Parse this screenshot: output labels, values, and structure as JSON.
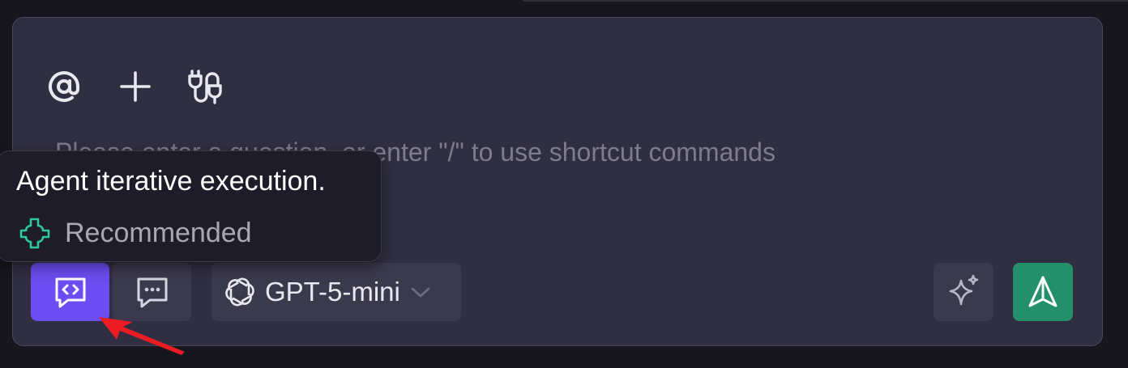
{
  "composer": {
    "toolbar_icons": [
      "at-sign-icon",
      "plus-icon",
      "plug-icon"
    ],
    "input_placeholder": "Please enter a question, or enter \"/\" to use shortcut commands",
    "input_value": ""
  },
  "tooltip": {
    "title": "Agent iterative execution.",
    "recommended_label": "Recommended"
  },
  "footer": {
    "modes": [
      {
        "icon": "code-message-icon",
        "active": true
      },
      {
        "icon": "chat-message-icon",
        "active": false
      }
    ],
    "model": {
      "icon": "openai-logo-icon",
      "label": "GPT-5-mini"
    },
    "enhance_icon": "sparkles-icon",
    "send_icon": "send-icon"
  },
  "colors": {
    "page_background": "#17161f",
    "panel_background": "#302f42",
    "active_mode": "#6c4df2",
    "send_button": "#23906b",
    "recommended_icon": "#2fc6a0",
    "annotation_arrow": "#ec1c24"
  }
}
